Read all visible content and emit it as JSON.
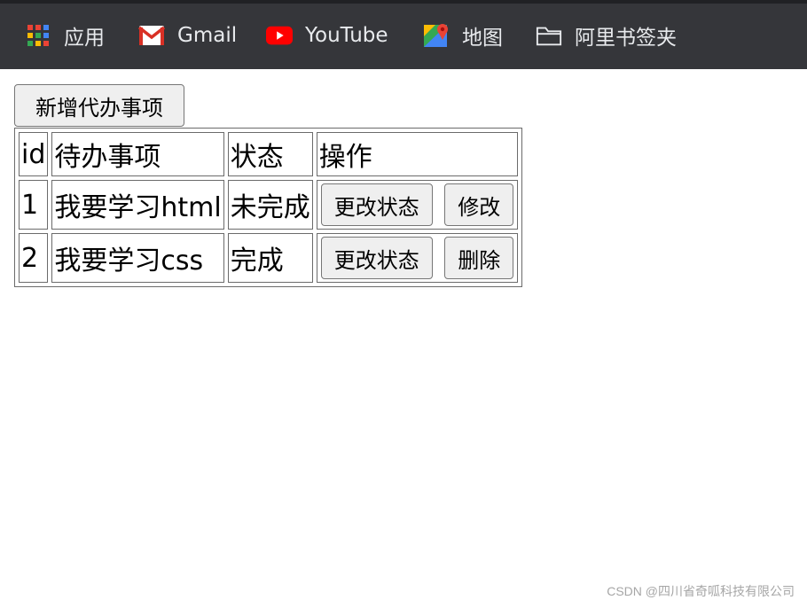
{
  "bookmarks": {
    "items": [
      {
        "label": "应用",
        "icon": "apps-grid-icon"
      },
      {
        "label": "Gmail",
        "icon": "gmail-icon"
      },
      {
        "label": "YouTube",
        "icon": "youtube-icon"
      },
      {
        "label": "地图",
        "icon": "maps-icon"
      },
      {
        "label": "阿里书签夹",
        "icon": "folder-icon"
      }
    ]
  },
  "toolbar": {
    "add_label": "新增代办事项"
  },
  "table": {
    "headers": [
      "id",
      "待办事项",
      "状态",
      "操作"
    ],
    "rows": [
      {
        "id": "1",
        "task": "我要学习html",
        "status": "未完成",
        "actions": [
          "更改状态",
          "修改"
        ]
      },
      {
        "id": "2",
        "task": "我要学习css",
        "status": "完成",
        "actions": [
          "更改状态",
          "删除"
        ]
      }
    ]
  },
  "watermark": "CSDN @四川省奇呱科技有限公司",
  "colors": {
    "bookmark_bar_bg": "#35363a",
    "bookmark_text": "#e8eaed",
    "button_bg": "#efefef",
    "border": "#6b6b6b"
  }
}
